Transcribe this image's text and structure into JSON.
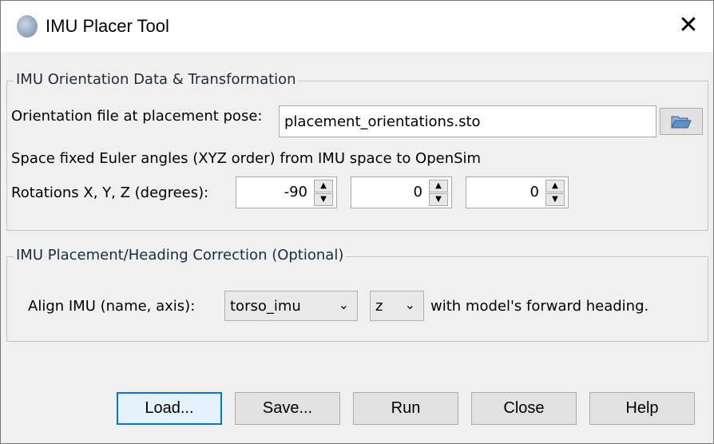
{
  "window": {
    "title": "IMU Placer Tool"
  },
  "orientation_group": {
    "title": "IMU Orientation Data & Transformation",
    "file_label": "Orientation file at placement pose:",
    "file_value": "placement_orientations.sto",
    "euler_note": "Space fixed Euler angles (XYZ order) from IMU space to OpenSim",
    "rotations_label": "Rotations X, Y, Z (degrees):",
    "rotations": [
      "-90",
      "0",
      "0"
    ]
  },
  "heading_group": {
    "title": "IMU Placement/Heading Correction (Optional)",
    "align_label": "Align IMU (name, axis):",
    "imu_name": "torso_imu",
    "axis": "z",
    "suffix": "with model's forward heading."
  },
  "buttons": {
    "load": "Load...",
    "save": "Save...",
    "run": "Run",
    "close": "Close",
    "help": "Help"
  }
}
